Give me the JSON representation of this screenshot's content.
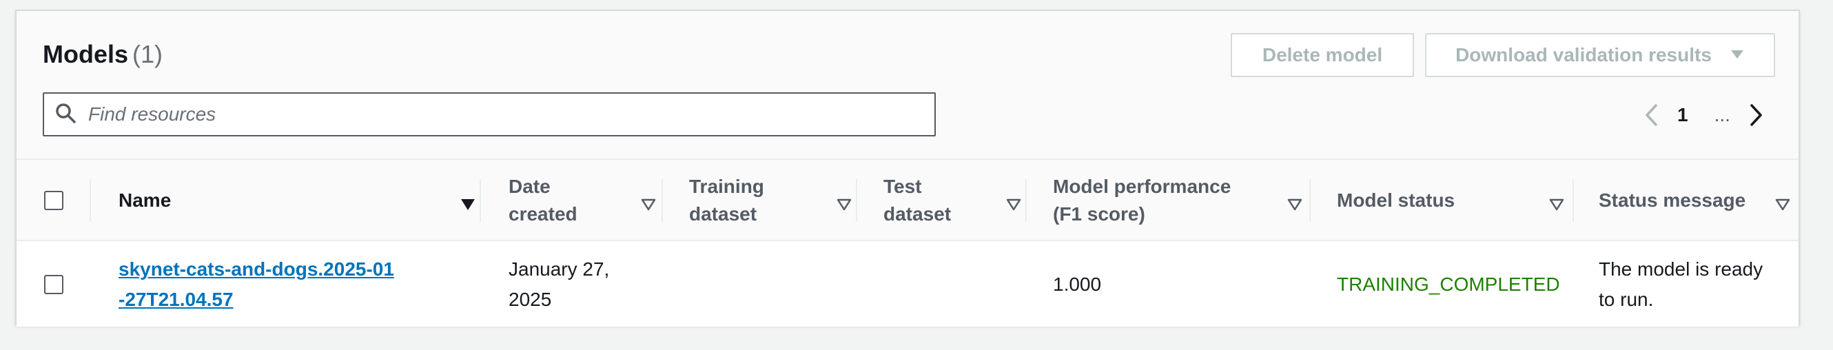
{
  "header": {
    "title": "Models",
    "count": "(1)",
    "delete_label": "Delete model",
    "download_label": "Download validation results"
  },
  "search": {
    "placeholder": "Find resources",
    "value": ""
  },
  "pagination": {
    "current_page": "1",
    "ellipsis": "..."
  },
  "table": {
    "columns": [
      {
        "label": "Name",
        "sort": "sorted-descending"
      },
      {
        "label": "Date created",
        "sort": "sortable"
      },
      {
        "label": "Training dataset",
        "sort": "sortable"
      },
      {
        "label": "Test dataset",
        "sort": "sortable"
      },
      {
        "label": "Model performance (F1 score)",
        "sort": "sortable"
      },
      {
        "label": "Model status",
        "sort": "sortable"
      },
      {
        "label": "Status message",
        "sort": "sortable"
      }
    ],
    "rows": [
      {
        "selected": false,
        "name": "skynet-cats-and-dogs.2025-01-27T21.04.57",
        "date_created": "January 27, 2025",
        "training_dataset": "",
        "test_dataset": "",
        "f1_score": "1.000",
        "model_status": "TRAINING_COMPLETED",
        "status_message": "The model is ready to run."
      }
    ]
  },
  "colors": {
    "link": "#0073bb",
    "status_success": "#1d8102",
    "disabled_text": "#aab7b8",
    "header_bg": "#fafafa"
  },
  "icons": {
    "search": "search-icon",
    "prev": "chevron-left-icon",
    "next": "chevron-right-icon",
    "dropdown": "caret-down-icon",
    "sort_active": "sort-descending-icon",
    "sort_inactive": "sort-icon"
  }
}
